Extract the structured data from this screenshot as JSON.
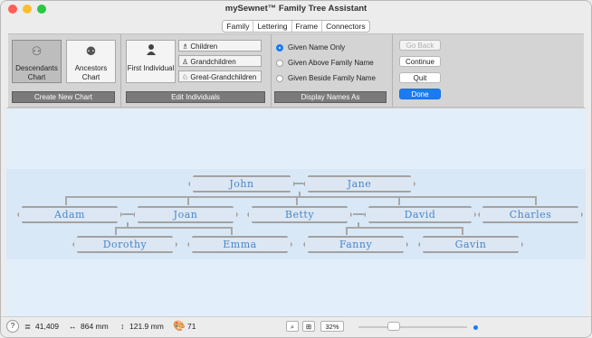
{
  "window": {
    "title": "mySewnet™ Family Tree Assistant"
  },
  "tabs": [
    {
      "label": "Family",
      "active": true
    },
    {
      "label": "Lettering",
      "active": false
    },
    {
      "label": "Frame",
      "active": false
    },
    {
      "label": "Connectors",
      "active": false
    }
  ],
  "ribbon": {
    "create_chart": {
      "caption": "Create New Chart",
      "descendants": "Descendants Chart",
      "ancestors": "Ancestors Chart"
    },
    "edit_individuals": {
      "caption": "Edit Individuals",
      "first_individual": "First Individual",
      "children": "Children",
      "grandchildren": "Grandchildren",
      "great_grandchildren": "Great-Grandchildren"
    },
    "display_names": {
      "caption": "Display Names As",
      "options": [
        {
          "label": "Given Name Only",
          "selected": true
        },
        {
          "label": "Given Above Family Name",
          "selected": false
        },
        {
          "label": "Given Beside Family Name",
          "selected": false
        }
      ]
    },
    "actions": {
      "go_back": "Go Back",
      "continue": "Continue",
      "quit": "Quit",
      "done": "Done"
    }
  },
  "tree": {
    "generation1": [
      "John",
      "Jane"
    ],
    "generation2": [
      "Adam",
      "Joan",
      "Betty",
      "David",
      "Charles"
    ],
    "generation3": [
      "Dorothy",
      "Emma",
      "Fanny",
      "Gavin"
    ]
  },
  "status": {
    "help": "?",
    "stitches": "41,409",
    "width": "864 mm",
    "height": "121.9 mm",
    "colors": "71",
    "zoom": "32%",
    "zoom_slider_fraction": 0.3
  },
  "colors": {
    "accent": "#1a7cf5",
    "name_text": "#4a86c8",
    "canvas": "#e2eef9"
  }
}
